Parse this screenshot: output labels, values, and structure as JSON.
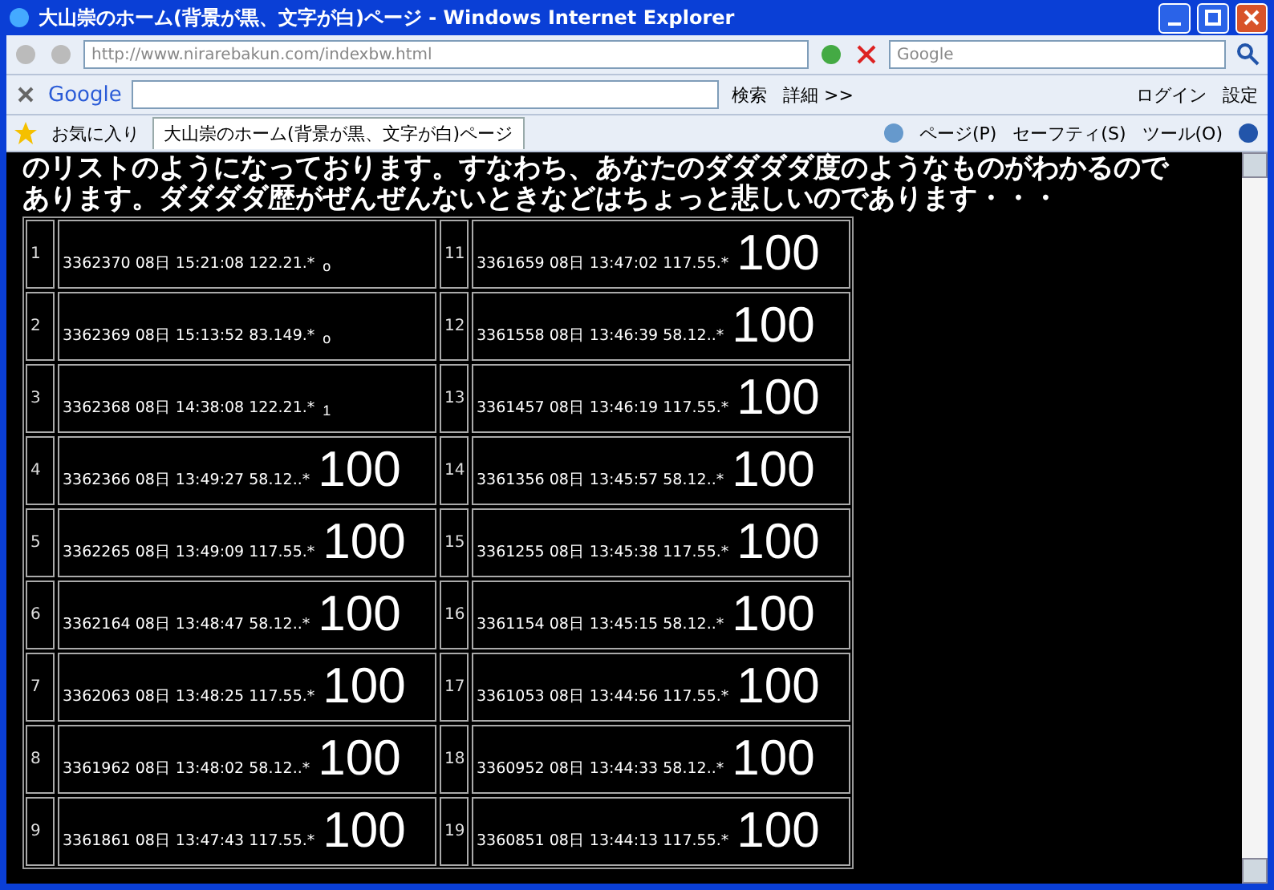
{
  "window": {
    "title": "大山崇のホーム(背景が黒、文字が白)ページ - Windows Internet Explorer"
  },
  "address_bar": {
    "url": "http://www.nirarebakun.com/indexbw.html",
    "search_placeholder": "Google"
  },
  "google_toolbar": {
    "logo": "Google",
    "search_button": "検索",
    "more_button": "詳細 >>",
    "login": "ログイン",
    "settings": "設定"
  },
  "tab_bar": {
    "favorites": "お気に入り",
    "tabs": [
      {
        "label": "大山崇のホーム(背景が黒、文字が白)ページ",
        "selected": true
      }
    ],
    "commands": [
      "ページ(P)",
      "セーフティ(S)",
      "ツール(O)"
    ]
  },
  "page": {
    "paragraph_lines": [
      "のリストのようになっております。すなわち、あなたのダダダダ度のようなものがわかるので",
      "あります。ダダダダ歴がぜんぜんないときなどはちょっと悲しいのであります・・・"
    ],
    "rows": [
      {
        "left": {
          "index": "1",
          "entry": "3362370 08日 15:21:08 122.21.*",
          "score": "o",
          "kind": "small"
        },
        "right": {
          "index": "11",
          "entry": "3361659 08日 13:47:02 117.55.*",
          "score": "100",
          "kind": "large"
        }
      },
      {
        "left": {
          "index": "2",
          "entry": "3362369 08日 15:13:52 83.149.*",
          "score": "o",
          "kind": "small"
        },
        "right": {
          "index": "12",
          "entry": "3361558 08日 13:46:39 58.12..*",
          "score": "100",
          "kind": "large"
        }
      },
      {
        "left": {
          "index": "3",
          "entry": "3362368 08日 14:38:08 122.21.*",
          "score": "1",
          "kind": "small"
        },
        "right": {
          "index": "13",
          "entry": "3361457 08日 13:46:19 117.55.*",
          "score": "100",
          "kind": "large"
        }
      },
      {
        "left": {
          "index": "4",
          "entry": "3362366 08日 13:49:27 58.12..*",
          "score": "100",
          "kind": "large"
        },
        "right": {
          "index": "14",
          "entry": "3361356 08日 13:45:57 58.12..*",
          "score": "100",
          "kind": "large"
        }
      },
      {
        "left": {
          "index": "5",
          "entry": "3362265 08日 13:49:09 117.55.*",
          "score": "100",
          "kind": "large"
        },
        "right": {
          "index": "15",
          "entry": "3361255 08日 13:45:38 117.55.*",
          "score": "100",
          "kind": "large"
        }
      },
      {
        "left": {
          "index": "6",
          "entry": "3362164 08日 13:48:47 58.12..*",
          "score": "100",
          "kind": "large"
        },
        "right": {
          "index": "16",
          "entry": "3361154 08日 13:45:15 58.12..*",
          "score": "100",
          "kind": "large"
        }
      },
      {
        "left": {
          "index": "7",
          "entry": "3362063 08日 13:48:25 117.55.*",
          "score": "100",
          "kind": "large"
        },
        "right": {
          "index": "17",
          "entry": "3361053 08日 13:44:56 117.55.*",
          "score": "100",
          "kind": "large"
        }
      },
      {
        "left": {
          "index": "8",
          "entry": "3361962 08日 13:48:02 58.12..*",
          "score": "100",
          "kind": "large"
        },
        "right": {
          "index": "18",
          "entry": "3360952 08日 13:44:33 58.12..*",
          "score": "100",
          "kind": "large"
        }
      },
      {
        "left": {
          "index": "9",
          "entry": "3361861 08日 13:47:43 117.55.*",
          "score": "100",
          "kind": "large"
        },
        "right": {
          "index": "19",
          "entry": "3360851 08日 13:44:13 117.55.*",
          "score": "100",
          "kind": "large"
        }
      }
    ]
  }
}
